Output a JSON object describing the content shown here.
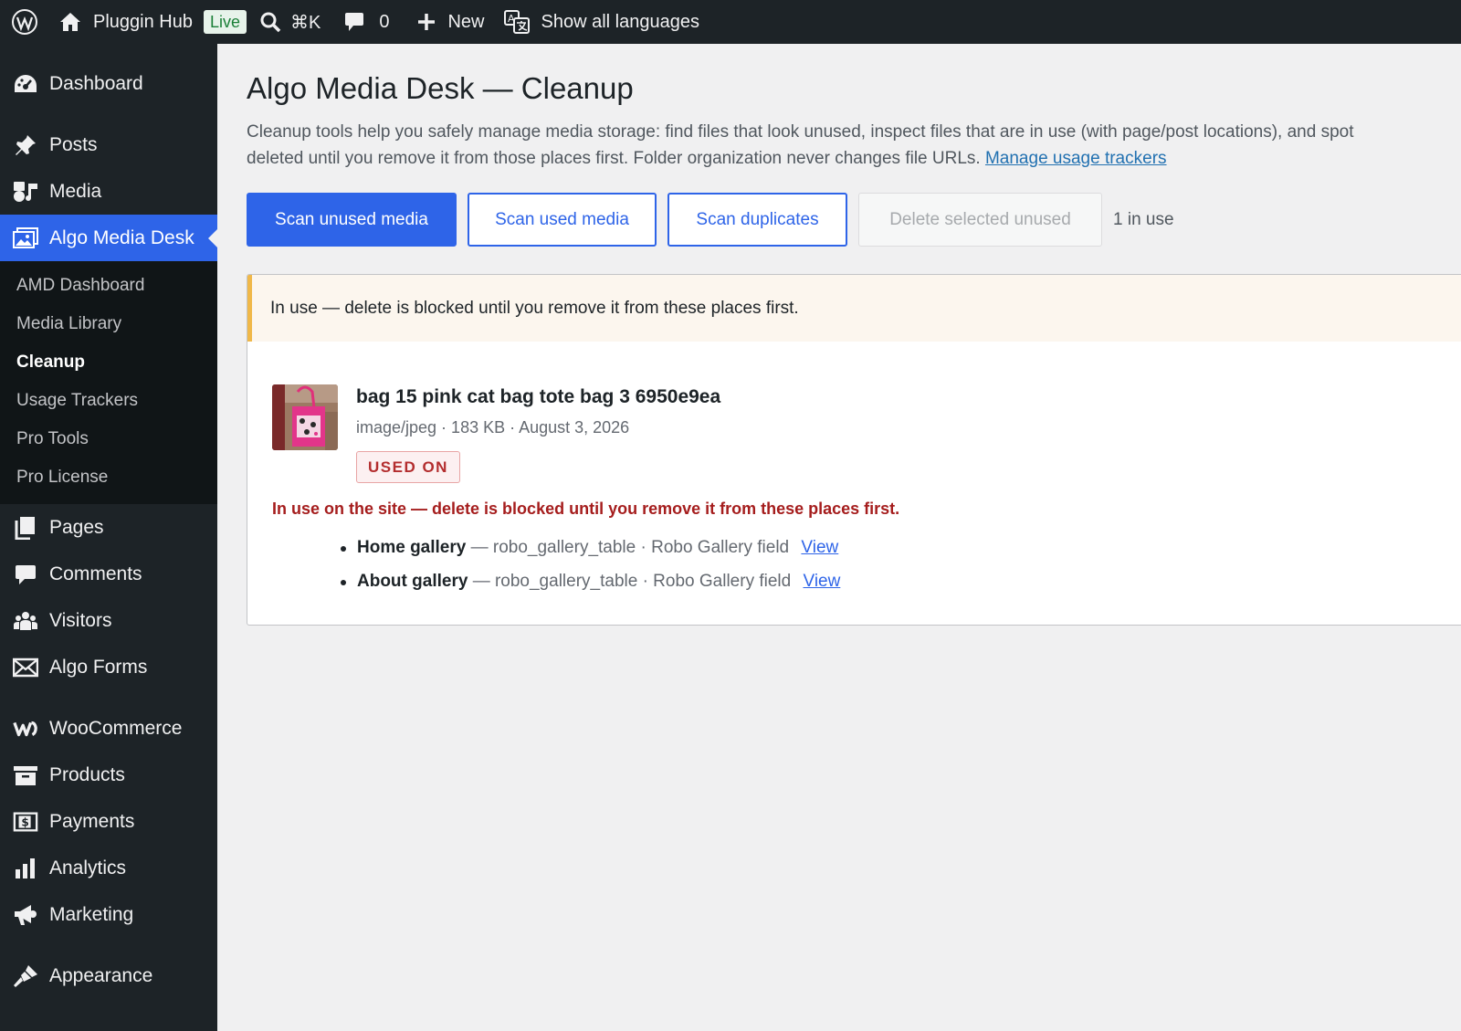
{
  "adminbar": {
    "site_name": "Pluggin Hub",
    "live_badge": "Live",
    "search_shortcut": "⌘K",
    "comments_count": "0",
    "new_label": "New",
    "languages_label": "Show all languages"
  },
  "sidebar": {
    "items": [
      {
        "label": "Dashboard",
        "icon": "dashboard-icon"
      },
      {
        "label": "Posts",
        "icon": "pin-icon"
      },
      {
        "label": "Media",
        "icon": "media-icon"
      },
      {
        "label": "Algo Media Desk",
        "icon": "gallery-icon"
      },
      {
        "label": "Pages",
        "icon": "pages-icon"
      },
      {
        "label": "Comments",
        "icon": "comment-icon"
      },
      {
        "label": "Visitors",
        "icon": "visitors-icon"
      },
      {
        "label": "Algo Forms",
        "icon": "mail-icon"
      },
      {
        "label": "WooCommerce",
        "icon": "woocommerce-icon"
      },
      {
        "label": "Products",
        "icon": "archive-icon"
      },
      {
        "label": "Payments",
        "icon": "payments-icon"
      },
      {
        "label": "Analytics",
        "icon": "bar-chart-icon"
      },
      {
        "label": "Marketing",
        "icon": "megaphone-icon"
      },
      {
        "label": "Appearance",
        "icon": "brush-icon"
      }
    ],
    "submenu": [
      {
        "label": "AMD Dashboard"
      },
      {
        "label": "Media Library"
      },
      {
        "label": "Cleanup"
      },
      {
        "label": "Usage Trackers"
      },
      {
        "label": "Pro Tools"
      },
      {
        "label": "Pro License"
      }
    ]
  },
  "page": {
    "title": "Algo Media Desk — Cleanup",
    "intro_line1": "Cleanup tools help you safely manage media storage: find files that look unused, inspect files that are in use (with page/post locations), and spot",
    "intro_line2": "deleted until you remove it from those places first. Folder organization never changes file URLs.",
    "intro_link": "Manage usage trackers"
  },
  "actions": {
    "scan_unused": "Scan unused media",
    "scan_used": "Scan used media",
    "scan_duplicates": "Scan duplicates",
    "delete_selected": "Delete selected unused",
    "count": "1 in use"
  },
  "result": {
    "notice": "In use — delete is blocked until you remove it from these places first.",
    "file_name": "bag 15 pink cat bag tote bag 3 6950e9ea",
    "file_meta": "image/jpeg · 183 KB · August 3, 2026",
    "badge": "USED ON",
    "blocked_message": "In use on the site — delete is blocked until you remove it from these places first.",
    "usages": [
      {
        "title": "Home gallery",
        "detail": "— robo_gallery_table · Robo Gallery field",
        "link": "View"
      },
      {
        "title": "About gallery",
        "detail": "— robo_gallery_table · Robo Gallery field",
        "link": "View"
      }
    ]
  },
  "colors": {
    "accent": "#2e64e8",
    "admin_bar": "#1d2327",
    "danger": "#a51d1d",
    "notice_border": "#f0b849"
  }
}
